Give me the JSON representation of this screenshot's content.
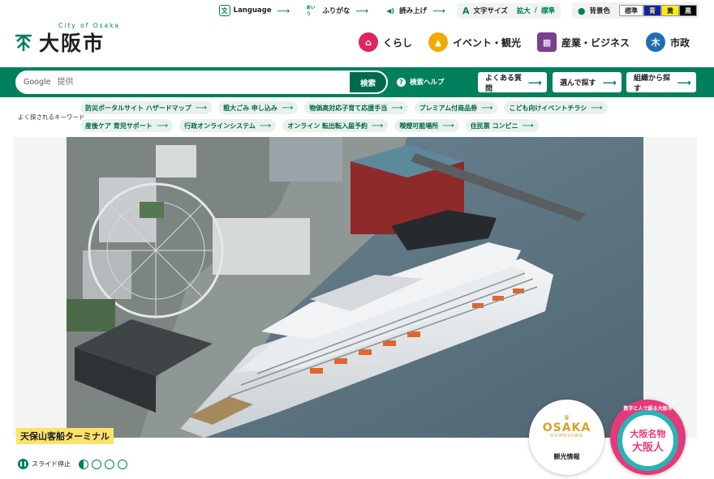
{
  "utility": {
    "language": "Language",
    "furigana": "ふりがな",
    "read_aloud": "読み上げ",
    "font_size_label": "文字サイズ",
    "font_enlarge": "拡大",
    "font_standard": "標準",
    "bg_color_label": "背景色",
    "bg_standard": "標準",
    "bg_blue": "青",
    "bg_yellow": "黄",
    "bg_black": "黒",
    "furigana_icon": "あいう"
  },
  "logo": {
    "city_en": "City of Osaka",
    "name": "大阪市"
  },
  "global_nav": [
    {
      "label": "くらし",
      "icon": "house-icon",
      "color": "#e0245e"
    },
    {
      "label": "イベント・観光",
      "icon": "event-icon",
      "color": "#f2a900"
    },
    {
      "label": "産業・ビジネス",
      "icon": "building-icon",
      "color": "#7a3f8f"
    },
    {
      "label": "市政",
      "icon": "city-emblem-icon",
      "color": "#1e6eb5"
    }
  ],
  "search": {
    "brand": "Google",
    "placeholder": "提供",
    "button": "検索",
    "help": "検索ヘルプ"
  },
  "quick_links": [
    "よくある質問",
    "選んで探す",
    "組織から探す"
  ],
  "keywords": {
    "label": "よく探されるキーワード",
    "row1": [
      "防災ポータルサイト ハザードマップ",
      "粗大ごみ 申し込み",
      "物価高対応子育て応援手当",
      "プレミアム付商品券",
      "こども向けイベントチラシ"
    ],
    "row2": [
      "産後ケア 育児サポート",
      "行政オンラインシステム",
      "オンライン 転出転入届予約",
      "喫煙可能場所",
      "住民票 コンビニ"
    ]
  },
  "hero": {
    "caption": "天保山客船ターミナル",
    "slide_stop": "スライド停止"
  },
  "banners": {
    "kanko_label": "観光情報",
    "kanko_logo": "OSAKA",
    "kanko_sub": "DOWNTOWN",
    "meibutsu_top": "数字と人で語る大阪市",
    "meibutsu_line1": "大阪名物",
    "meibutsu_line2": "大阪人"
  },
  "colors": {
    "brand_green": "#00805c",
    "keyword_bg": "#e9f1ec",
    "caption_bg": "#fbe26a"
  }
}
